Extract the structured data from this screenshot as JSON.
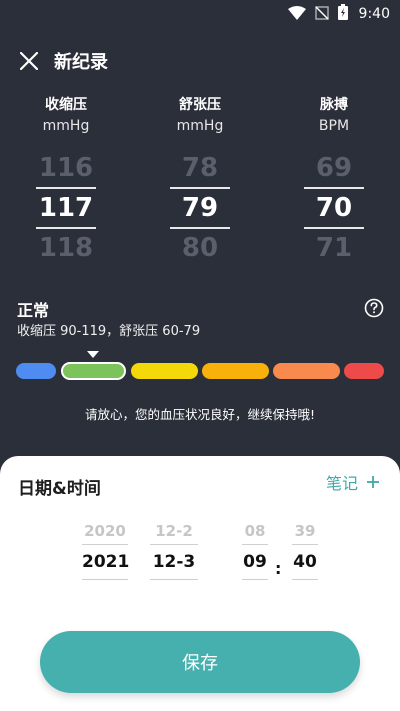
{
  "status_bar": {
    "time": "9:40"
  },
  "header": {
    "title": "新纪录"
  },
  "pickers": [
    {
      "label": "收缩压",
      "unit": "mmHg",
      "prev": "116",
      "current": "117",
      "next": "118"
    },
    {
      "label": "舒张压",
      "unit": "mmHg",
      "prev": "78",
      "current": "79",
      "next": "80"
    },
    {
      "label": "脉搏",
      "unit": "BPM",
      "prev": "69",
      "current": "70",
      "next": "71"
    }
  ],
  "status": {
    "title": "正常",
    "range": "收缩压 90-119，舒张压 60-79",
    "advice": "请放心，您的血压状况良好，继续保持哦!",
    "selected_level_index": 1,
    "levels": [
      "#4f8cf2",
      "#7bc35a",
      "#f5d80a",
      "#f8b00b",
      "#f78a4c",
      "#ee4a4a"
    ]
  },
  "sheet": {
    "title": "日期&时间",
    "note_label": "笔记",
    "date_year": {
      "prev": "2020",
      "current": "2021"
    },
    "date_day": {
      "prev": "12-2",
      "current": "12-3"
    },
    "time_hour": {
      "prev": "08",
      "current": "09"
    },
    "time_minute": {
      "prev": "39",
      "current": "40"
    },
    "time_separator": ":",
    "save_label": "保存"
  },
  "colors": {
    "background": "#2b2f3a",
    "accent": "#45b0ad",
    "note": "#41a7a7"
  }
}
